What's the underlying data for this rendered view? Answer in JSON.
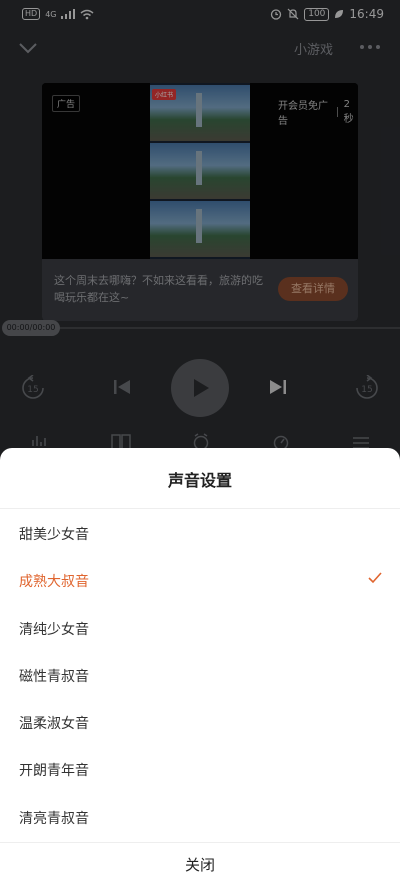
{
  "status_bar": {
    "hd": "HD",
    "network": "4G",
    "battery": "100",
    "time": "16:49"
  },
  "top_bar": {
    "mini_game": "小游戏"
  },
  "ad": {
    "tag": "广告",
    "logo": "小红书",
    "vip_skip": "开会员免广告",
    "countdown": "2秒",
    "description": "这个周末去哪嗨？不如来这看看，旅游的吃喝玩乐都在这~",
    "cta": "查看详情"
  },
  "player": {
    "time_display": "00:00/00:00",
    "rewind_seconds": "15",
    "forward_seconds": "15"
  },
  "sheet": {
    "title": "声音设置",
    "options": [
      {
        "label": "甜美少女音",
        "selected": false
      },
      {
        "label": "成熟大叔音",
        "selected": true
      },
      {
        "label": "清纯少女音",
        "selected": false
      },
      {
        "label": "磁性青叔音",
        "selected": false
      },
      {
        "label": "温柔淑女音",
        "selected": false
      },
      {
        "label": "开朗青年音",
        "selected": false
      },
      {
        "label": "清亮青叔音",
        "selected": false
      }
    ],
    "close_label": "关闭"
  },
  "colors": {
    "accent": "#e0652f",
    "background": "#2b2d31",
    "sheet": "#ffffff"
  }
}
